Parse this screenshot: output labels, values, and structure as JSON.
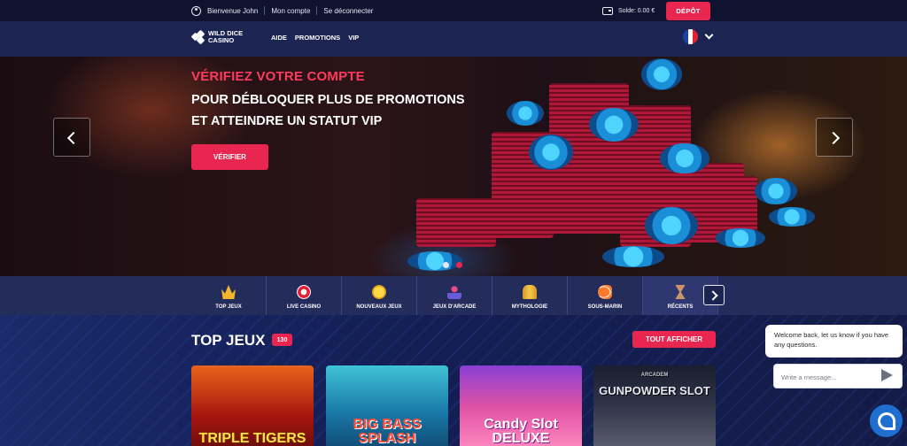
{
  "topbar": {
    "welcome": "Bienvenue John",
    "account_link": "Mon compte",
    "logout_link": "Se déconnecter",
    "balance": "Solde: 0.00 €",
    "deposit_label": "DÉPÔT"
  },
  "nav": {
    "logo_line1": "WILD DICE",
    "logo_line2": "CASINO",
    "links": [
      "AIDE",
      "PROMOTIONS",
      "VIP"
    ],
    "language_flag": "france-flag"
  },
  "hero": {
    "title": "VÉRIFIEZ VOTRE COMPTE",
    "subtitle_line1": "POUR DÉBLOQUER PLUS DE PROMOTIONS",
    "subtitle_line2": "ET ATTEINDRE UN STATUT VIP",
    "verify_label": "VÉRIFIER",
    "slides_total": 2,
    "active_slide": 2
  },
  "categories": [
    {
      "label": "TOP JEUX",
      "icon": "crown-icon"
    },
    {
      "label": "LIVE CASINO",
      "icon": "roulette-chip-icon"
    },
    {
      "label": "NOUVEAUX JEUX",
      "icon": "new-badge-icon"
    },
    {
      "label": "JEUX D'ARCADE",
      "icon": "joystick-icon"
    },
    {
      "label": "MYTHOLOGIE",
      "icon": "pharaoh-icon"
    },
    {
      "label": "SOUS-MARIN",
      "icon": "fish-icon"
    },
    {
      "label": "RÉCENTS",
      "icon": "hourglass-icon"
    }
  ],
  "section": {
    "title": "TOP JEUX",
    "count": "130",
    "show_all_label": "TOUT AFFICHER"
  },
  "games": [
    {
      "title": "TRIPLE TIGERS"
    },
    {
      "title": "BIG BASS SPLASH"
    },
    {
      "title": "Candy Slot DELUXE"
    },
    {
      "brand": "ARCADEM",
      "title": "GUNPOWDER SLOT"
    }
  ],
  "chat": {
    "message": "Welcome back, let us know if you have any questions.",
    "input_placeholder": "Write a message..."
  },
  "colors": {
    "accent": "#e8264f",
    "nav_bg": "#1c2452",
    "topbar_bg": "#0f1330",
    "chat_button": "#1e6fd0"
  }
}
